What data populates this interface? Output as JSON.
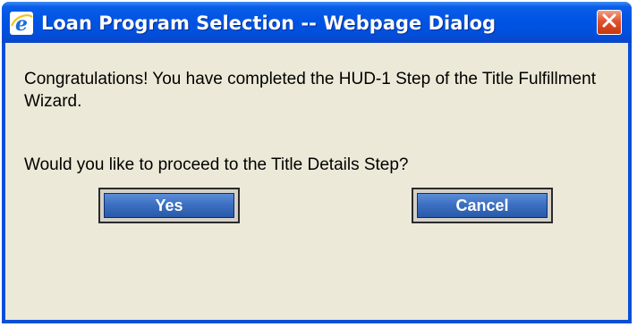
{
  "dialog": {
    "title": "Loan Program Selection -- Webpage Dialog",
    "message": "Congratulations! You have completed the HUD-1 Step of the Title Fulfillment Wizard.",
    "question": "Would you like to proceed to the Title Details Step?",
    "yes_label": "Yes",
    "cancel_label": "Cancel"
  },
  "icons": {
    "app": "internet-explorer-icon",
    "close": "close-icon"
  },
  "colors": {
    "titlebar": "#0054e3",
    "client_bg": "#ece9d8",
    "button_blue": "#3d70c2",
    "close_red": "#e0522e"
  }
}
